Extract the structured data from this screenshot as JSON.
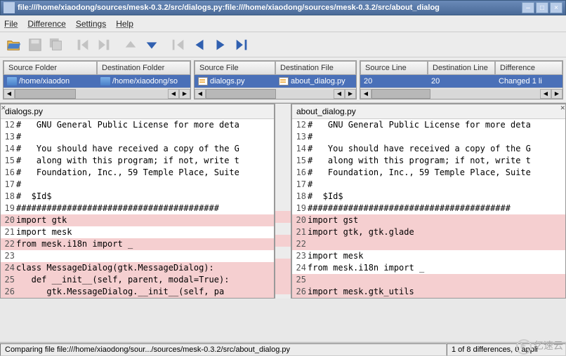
{
  "window": {
    "title": "file:///home/xiaodong/sources/mesk-0.3.2/src/dialogs.py:file:///home/xiaodong/sources/mesk-0.3.2/src/about_dialog"
  },
  "menu": {
    "file": "File",
    "difference": "Difference",
    "settings": "Settings",
    "help": "Help"
  },
  "folders": {
    "src_header": "Source Folder",
    "dst_header": "Destination Folder",
    "src_path": "/home/xiaodon",
    "dst_path": "/home/xiaodong/so"
  },
  "files": {
    "src_header": "Source File",
    "dst_header": "Destination File",
    "src_file": "dialogs.py",
    "dst_file": "about_dialog.py"
  },
  "lines": {
    "src_header": "Source Line",
    "dst_header": "Destination Line",
    "diff_header": "Difference",
    "src_line": "20",
    "dst_line": "20",
    "diff_text": "Changed 1 li"
  },
  "left": {
    "filename": "dialogs.py",
    "rows": [
      {
        "n": "12",
        "t": "#   GNU General Public License for more deta",
        "d": false
      },
      {
        "n": "13",
        "t": "#",
        "d": false
      },
      {
        "n": "14",
        "t": "#   You should have received a copy of the G",
        "d": false
      },
      {
        "n": "15",
        "t": "#   along with this program; if not, write t",
        "d": false
      },
      {
        "n": "16",
        "t": "#   Foundation, Inc., 59 Temple Place, Suite",
        "d": false
      },
      {
        "n": "17",
        "t": "#",
        "d": false
      },
      {
        "n": "18",
        "t": "#  $Id$",
        "d": false
      },
      {
        "n": "19",
        "t": "########################################",
        "d": false
      },
      {
        "n": "20",
        "t": "import gtk",
        "d": true
      },
      {
        "n": "21",
        "t": "import mesk",
        "d": false
      },
      {
        "n": "22",
        "t": "from mesk.i18n import _",
        "d": true
      },
      {
        "n": "23",
        "t": "",
        "d": false
      },
      {
        "n": "24",
        "t": "class MessageDialog(gtk.MessageDialog):",
        "d": true
      },
      {
        "n": "25",
        "t": "   def __init__(self, parent, modal=True):",
        "d": true
      },
      {
        "n": "26",
        "t": "      gtk.MessageDialog.__init__(self, pa",
        "d": true
      }
    ]
  },
  "right": {
    "filename": "about_dialog.py",
    "rows": [
      {
        "n": "12",
        "t": "#   GNU General Public License for more deta",
        "d": false
      },
      {
        "n": "13",
        "t": "#",
        "d": false
      },
      {
        "n": "14",
        "t": "#   You should have received a copy of the G",
        "d": false
      },
      {
        "n": "15",
        "t": "#   along with this program; if not, write t",
        "d": false
      },
      {
        "n": "16",
        "t": "#   Foundation, Inc., 59 Temple Place, Suite",
        "d": false
      },
      {
        "n": "17",
        "t": "#",
        "d": false
      },
      {
        "n": "18",
        "t": "#  $Id$",
        "d": false
      },
      {
        "n": "19",
        "t": "########################################",
        "d": false
      },
      {
        "n": "20",
        "t": "import gst",
        "d": true
      },
      {
        "n": "21",
        "t": "import gtk, gtk.glade",
        "d": true
      },
      {
        "n": "22",
        "t": "",
        "d": true
      },
      {
        "n": "23",
        "t": "import mesk",
        "d": false
      },
      {
        "n": "24",
        "t": "from mesk.i18n import _",
        "d": false
      },
      {
        "n": "25",
        "t": "",
        "d": true
      },
      {
        "n": "26",
        "t": "import mesk.gtk_utils",
        "d": true
      }
    ]
  },
  "status": {
    "main": "Comparing file file:///home/xiaodong/sour.../sources/mesk-0.3.2/src/about_dialog.py",
    "count": "1 of 8 differences, 0 appli"
  },
  "watermark": "亿速云"
}
